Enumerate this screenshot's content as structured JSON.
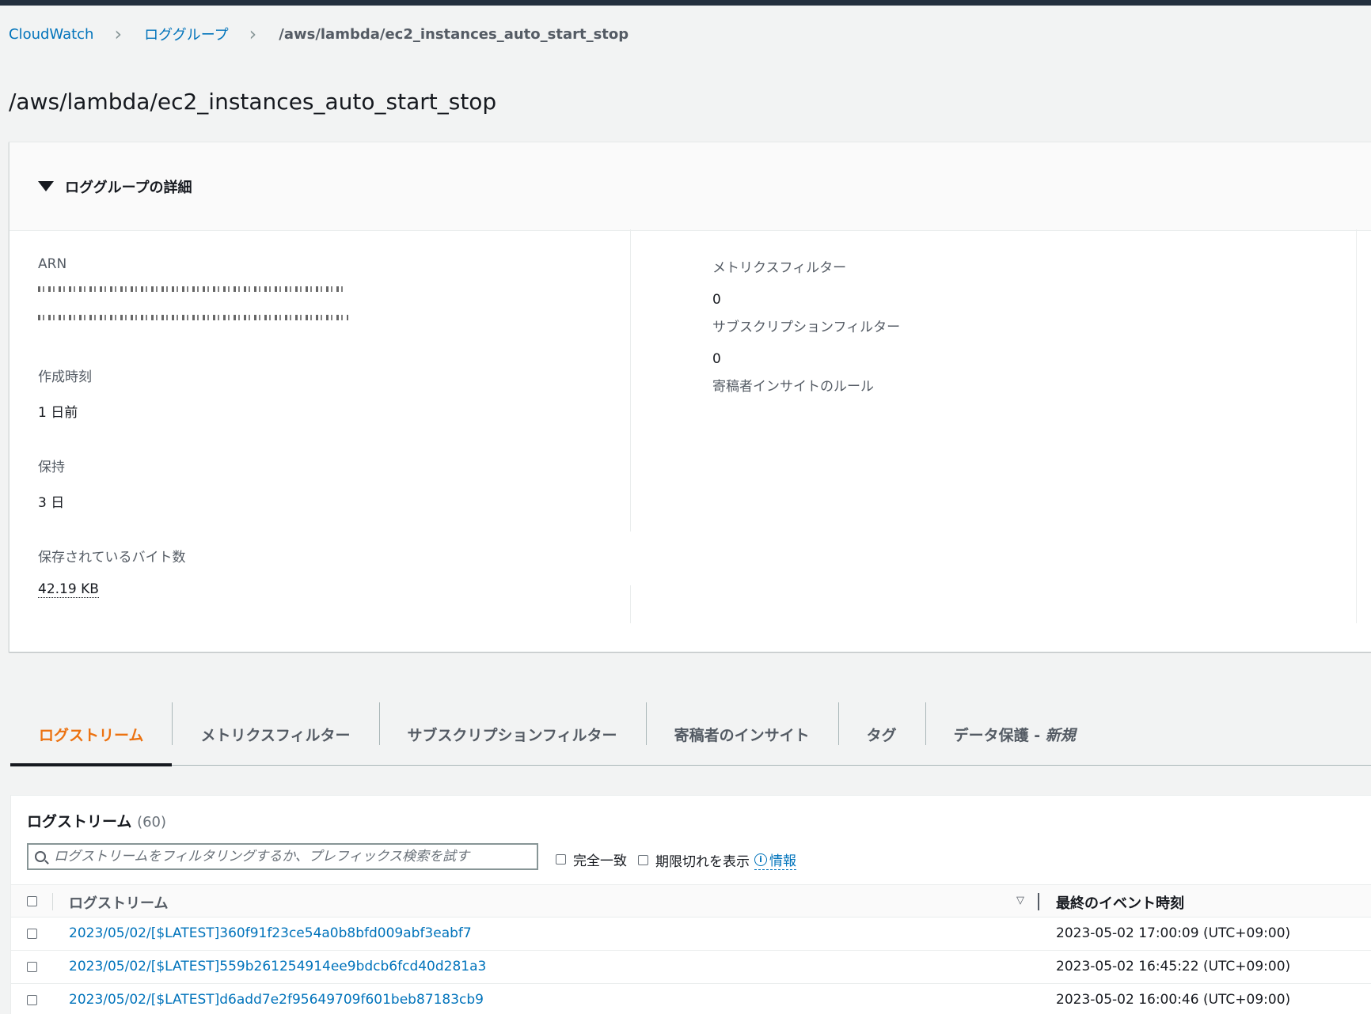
{
  "breadcrumb": {
    "items": [
      "CloudWatch",
      "ロググループ"
    ],
    "current": "/aws/lambda/ec2_instances_auto_start_stop"
  },
  "page": {
    "title": "/aws/lambda/ec2_instances_auto_start_stop"
  },
  "details": {
    "header": "ロググループの詳細",
    "arn_label": "ARN",
    "created_label": "作成時刻",
    "created_value": "1 日前",
    "retention_label": "保持",
    "retention_value": "3 日",
    "stored_bytes_label": "保存されているバイト数",
    "stored_bytes_value": "42.19 KB",
    "metric_filters_label": "メトリクスフィルター",
    "metric_filters_value": "0",
    "subscription_filters_label": "サブスクリプションフィルター",
    "subscription_filters_value": "0",
    "contributor_insights_label": "寄稿者インサイトのルール"
  },
  "tabs": [
    {
      "label": "ログストリーム",
      "active": true
    },
    {
      "label": "メトリクスフィルター"
    },
    {
      "label": "サブスクリプションフィルター"
    },
    {
      "label": "寄稿者のインサイト"
    },
    {
      "label": "タグ"
    },
    {
      "label": "データ保護 - ",
      "suffix": "新規"
    }
  ],
  "streams": {
    "title": "ログストリーム",
    "count": "(60)",
    "search_placeholder": "ログストリームをフィルタリングするか、プレフィックス検索を試す",
    "exact_match_label": "完全一致",
    "show_expired_label": "期限切れを表示",
    "info_label": "情報",
    "col_name": "ログストリーム",
    "col_last_event": "最終のイベント時刻",
    "rows": [
      {
        "name": "2023/05/02/[$LATEST]360f91f23ce54a0b8bfd009abf3eabf7",
        "time": "2023-05-02 17:00:09 (UTC+09:00)"
      },
      {
        "name": "2023/05/02/[$LATEST]559b261254914ee9bdcb6fcd40d281a3",
        "time": "2023-05-02 16:45:22 (UTC+09:00)"
      },
      {
        "name": "2023/05/02/[$LATEST]d6add7e2f95649709f601beb87183cb9",
        "time": "2023-05-02 16:00:46 (UTC+09:00)"
      }
    ]
  },
  "colors": {
    "link": "#0073bb",
    "active_tab": "#ec7211",
    "nav_bar": "#232f3e"
  }
}
